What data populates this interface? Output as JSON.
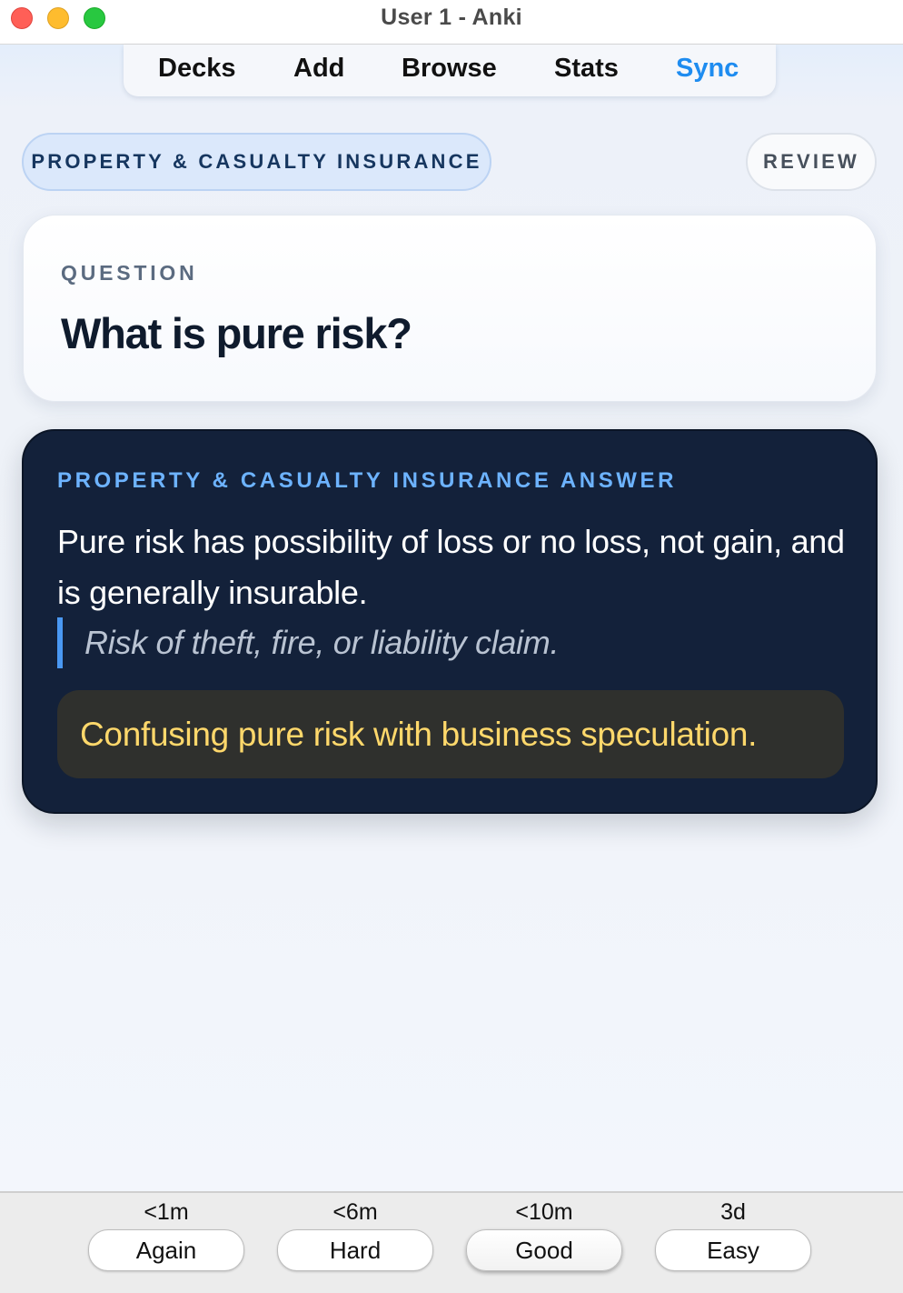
{
  "window": {
    "title": "User 1 - Anki"
  },
  "toolbar": {
    "decks": "Decks",
    "add": "Add",
    "browse": "Browse",
    "stats": "Stats",
    "sync": "Sync",
    "sync_color": "#1e8cf0"
  },
  "header": {
    "deck_name": "PROPERTY & CASUALTY INSURANCE",
    "mode": "REVIEW"
  },
  "question": {
    "label": "QUESTION",
    "text": "What is pure risk?"
  },
  "answer": {
    "label": "PROPERTY & CASUALTY INSURANCE ANSWER",
    "text": "Pure risk has possibility of loss or no loss, not gain, and is generally insurable.",
    "example": "Risk of theft, fire, or liability claim.",
    "pitfall": "Confusing pure risk with business speculation.",
    "label_color": "#6db3ff",
    "pitfall_color": "#ffd86b",
    "card_bg": "#13213a"
  },
  "ease_buttons": [
    {
      "time": "<1m",
      "label": "Again"
    },
    {
      "time": "<6m",
      "label": "Hard"
    },
    {
      "time": "<10m",
      "label": "Good"
    },
    {
      "time": "3d",
      "label": "Easy"
    }
  ]
}
